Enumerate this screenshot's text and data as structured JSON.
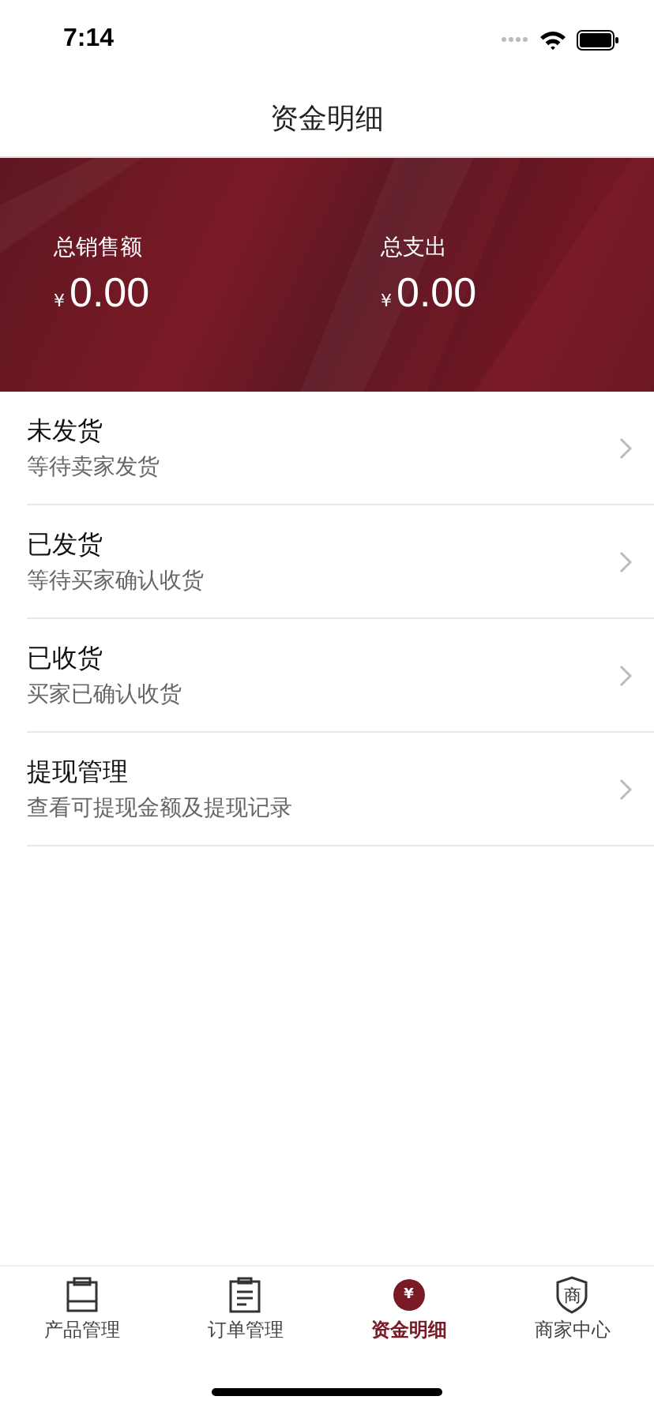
{
  "status_bar": {
    "time": "7:14"
  },
  "nav_bar": {
    "title": "资金明细"
  },
  "summary": [
    {
      "label": "总销售额",
      "currency": "¥",
      "amount": "0.00"
    },
    {
      "label": "总支出",
      "currency": "¥",
      "amount": "0.00"
    }
  ],
  "menu": [
    {
      "title": "未发货",
      "subtitle": "等待卖家发货"
    },
    {
      "title": "已发货",
      "subtitle": "等待买家确认收货"
    },
    {
      "title": "已收货",
      "subtitle": "买家已确认收货"
    },
    {
      "title": "提现管理",
      "subtitle": "查看可提现金额及提现记录"
    }
  ],
  "tab_bar": [
    {
      "kind": "bag",
      "label": "产品管理",
      "selected": false
    },
    {
      "kind": "clipboard",
      "label": "订单管理",
      "selected": false
    },
    {
      "kind": "coin",
      "glyph": "¥",
      "label": "资金明细",
      "selected": true
    },
    {
      "kind": "shield",
      "glyph": "商",
      "label": "商家中心",
      "selected": false
    }
  ]
}
